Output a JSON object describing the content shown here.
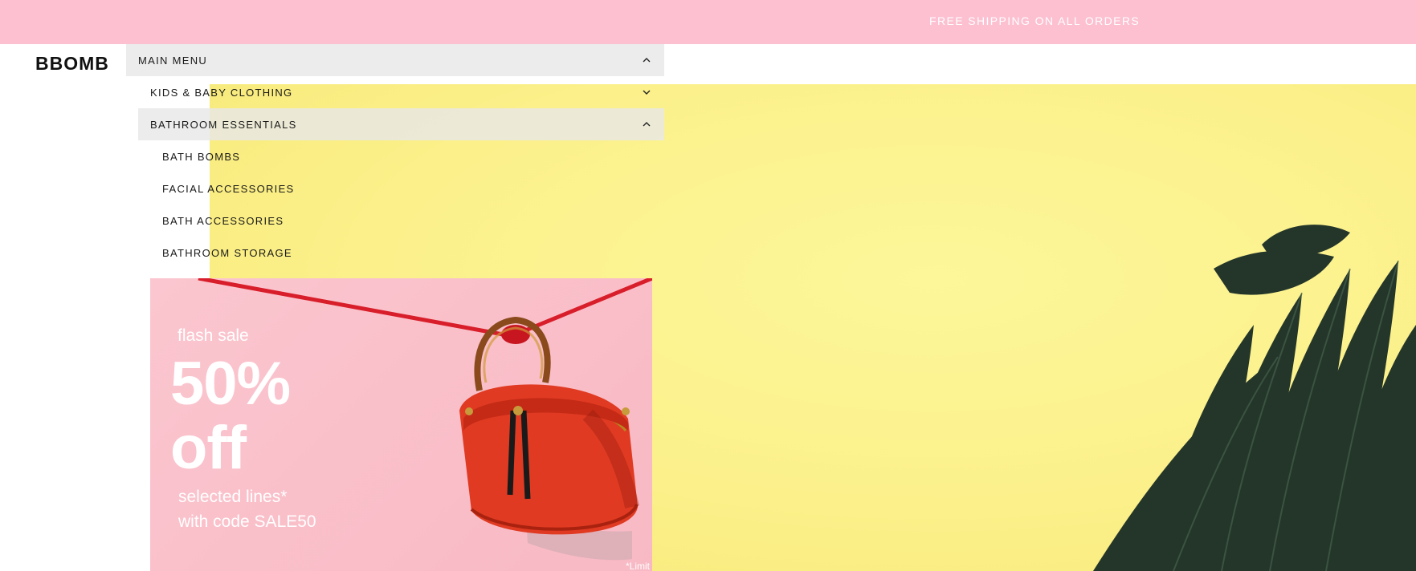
{
  "announcement": {
    "text": "FREE SHIPPING ON ALL ORDERS"
  },
  "brand": {
    "logo": "BBOMB"
  },
  "menu": {
    "main_label": "MAIN MENU",
    "categories": [
      {
        "label": "KIDS & BABY CLOTHING",
        "expanded": false
      },
      {
        "label": "BATHROOM ESSENTIALS",
        "expanded": true,
        "children": [
          "BATH BOMBS",
          "FACIAL ACCESSORIES",
          "BATH ACCESSORIES",
          "BATHROOM STORAGE"
        ]
      }
    ]
  },
  "promo": {
    "tag": "flash sale",
    "headline_1": "50%",
    "headline_2": "off",
    "subline_1": "selected lines*",
    "subline_2": "with code SALE50",
    "footnote": "*Limit"
  },
  "icons": {
    "expanded": "chevron-up-icon",
    "collapsed": "chevron-down-icon"
  },
  "colors": {
    "announcement_bar": "#fcc0d1",
    "hero_background": "#fbf08a",
    "promo_background": "#fbc6cf",
    "menu_highlight": "#e8e8e8"
  }
}
